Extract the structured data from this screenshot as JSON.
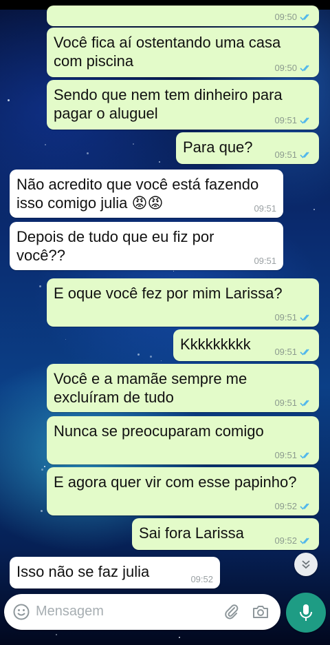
{
  "messages": [
    {
      "direction": "out",
      "text": "",
      "time": "09:50",
      "status": "read"
    },
    {
      "direction": "out",
      "text": "Você fica aí ostentando uma casa\ncom piscina",
      "time": "09:50",
      "status": "read"
    },
    {
      "direction": "out",
      "text": "Sendo que nem tem dinheiro para\npagar o aluguel",
      "time": "09:51",
      "status": "read"
    },
    {
      "direction": "out",
      "text": "Para que?",
      "time": "09:51",
      "status": "read"
    },
    {
      "direction": "in",
      "text": "Não acredito que você está fazendo\nisso comigo julia 😡😡",
      "time": "09:51"
    },
    {
      "direction": "in",
      "text": "Depois de tudo que eu fiz por\nvocê??",
      "time": "09:51"
    },
    {
      "direction": "out",
      "text": "E oque você fez por mim Larissa?",
      "time": "09:51",
      "status": "read"
    },
    {
      "direction": "out",
      "text": "Kkkkkkkkk",
      "time": "09:51",
      "status": "read"
    },
    {
      "direction": "out",
      "text": "Você e a mamãe sempre me\nexcluíram de tudo",
      "time": "09:51",
      "status": "read"
    },
    {
      "direction": "out",
      "text": "Nunca se preocuparam comigo",
      "time": "09:51",
      "status": "read"
    },
    {
      "direction": "out",
      "text": "E agora quer vir com esse papinho?",
      "time": "09:52",
      "status": "read"
    },
    {
      "direction": "out",
      "text": "Sai fora Larissa",
      "time": "09:52",
      "status": "read"
    },
    {
      "direction": "in",
      "text": "Isso não se faz julia",
      "time": "09:52"
    }
  ],
  "composer": {
    "placeholder": "Mensagem"
  },
  "icons": {
    "emoji": "emoji-icon",
    "attach": "paperclip-icon",
    "camera": "camera-icon",
    "mic": "mic-icon",
    "scroll": "double-chevron-down-icon",
    "read_receipt": "double-check-icon"
  },
  "colors": {
    "outgoing_bubble": "#e3fbc9",
    "incoming_bubble": "#ffffff",
    "read_ticks": "#4fb6ec",
    "mic_button": "#1e9c84"
  }
}
